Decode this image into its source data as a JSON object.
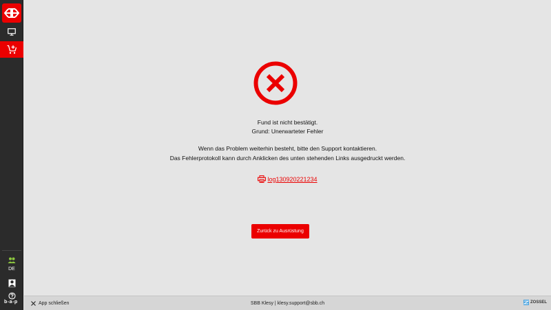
{
  "colors": {
    "accent": "#eb0000",
    "sidebar": "#2b2b2b",
    "background": "#e5e5e5",
    "footer": "#d6d6d6",
    "users_icon": "#8cc63f"
  },
  "sidebar": {
    "logo_icon": "sbb-logo-icon",
    "items": [
      {
        "icon": "desktop-icon"
      },
      {
        "icon": "cart-add-icon",
        "active": true
      }
    ],
    "bottom": {
      "users_icon": "users-icon",
      "language": "DE",
      "user_icon": "user-icon",
      "help_icon": "help-icon",
      "brand": "b-a-p"
    }
  },
  "main": {
    "status_icon": "error-circle-icon",
    "message_line1": "Fund ist nicht bestätigt.",
    "message_line2": "Grund: Unerwarteter Fehler",
    "support_line1": "Wenn das Problem weiterhin besteht, bitte den Support kontaktieren.",
    "support_line2": "Das Fehlerprotokoll kann durch Anklicken des unten stehenden Links ausgedruckt werden.",
    "log_link": "log130920221234",
    "back_button": "Zurück zu Ausrüstung"
  },
  "footer": {
    "close_label": "App schließen",
    "center_text": "SBB Klesy | klesy.support@sbb.ch",
    "logo_text": "ZOSSEL"
  }
}
